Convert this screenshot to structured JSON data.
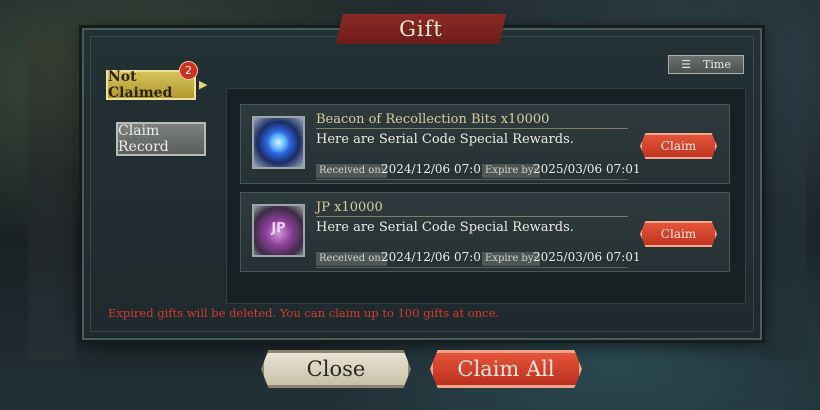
{
  "dialog": {
    "title": "Gift"
  },
  "tabs": {
    "not_claimed": {
      "label": "Not Claimed",
      "badge": "2"
    },
    "claim_record": {
      "label": "Claim Record"
    }
  },
  "sort": {
    "label": "Time"
  },
  "gifts": [
    {
      "name": "Beacon of Recollection Bits x10000",
      "description": "Here are Serial Code Special Rewards.",
      "received_label": "Received on:",
      "received": "2024/12/06 07:01",
      "expire_label": "Expire by:",
      "expire": "2025/03/06 07:01",
      "claim_label": "Claim",
      "icon": "blue-orb-icon"
    },
    {
      "name": "JP x10000",
      "description": "Here are Serial Code Special Rewards.",
      "received_label": "Received on:",
      "received": "2024/12/06 07:01",
      "expire_label": "Expire by:",
      "expire": "2025/03/06 07:01",
      "claim_label": "Claim",
      "icon": "jp-crystal-icon"
    }
  ],
  "footer_note": "Expired gifts will be deleted. You can claim up to 100 gifts at once.",
  "buttons": {
    "close": "Close",
    "claim_all": "Claim All"
  },
  "colors": {
    "accent_red": "#d4432b",
    "tab_gold": "#c9b246",
    "warning_text": "#d43b2e"
  }
}
